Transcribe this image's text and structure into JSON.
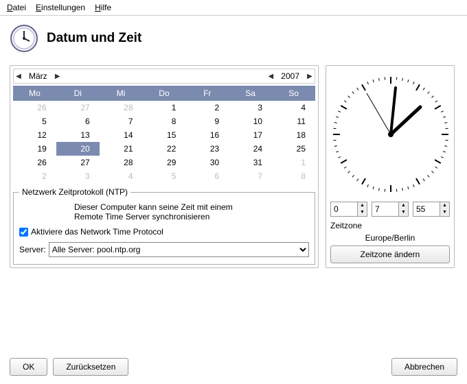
{
  "menu": {
    "file": "Datei",
    "settings": "Einstellungen",
    "help": "Hilfe"
  },
  "title": "Datum und Zeit",
  "month": "März",
  "year": "2007",
  "weekdays": [
    "Mo",
    "Di",
    "Mi",
    "Do",
    "Fr",
    "Sa",
    "So"
  ],
  "cal": {
    "r0": {
      "c0": "26",
      "c1": "27",
      "c2": "28",
      "c3": "1",
      "c4": "2",
      "c5": "3",
      "c6": "4"
    },
    "r1": {
      "c0": "5",
      "c1": "6",
      "c2": "7",
      "c3": "8",
      "c4": "9",
      "c5": "10",
      "c6": "11"
    },
    "r2": {
      "c0": "12",
      "c1": "13",
      "c2": "14",
      "c3": "15",
      "c4": "16",
      "c5": "17",
      "c6": "18"
    },
    "r3": {
      "c0": "19",
      "c1": "20",
      "c2": "21",
      "c3": "22",
      "c4": "23",
      "c5": "24",
      "c6": "25"
    },
    "r4": {
      "c0": "26",
      "c1": "27",
      "c2": "28",
      "c3": "29",
      "c4": "30",
      "c5": "31",
      "c6": "1"
    },
    "r5": {
      "c0": "2",
      "c1": "3",
      "c2": "4",
      "c3": "5",
      "c4": "6",
      "c5": "7",
      "c6": "8"
    }
  },
  "ntp": {
    "legend": "Netzwerk Zeitprotokoll (NTP)",
    "desc1": "Dieser Computer kann seine Zeit mit einem",
    "desc2": "Remote Time Server synchronisieren",
    "checkbox": "Aktiviere das Network Time Protocol",
    "server_label": "Server:",
    "server_value": "Alle Server: pool.ntp.org"
  },
  "time": {
    "h": "0",
    "m": "7",
    "s": "55"
  },
  "tz": {
    "label": "Zeitzone",
    "value": "Europe/Berlin",
    "button": "Zeitzone ändern"
  },
  "buttons": {
    "ok": "OK",
    "reset": "Zurücksetzen",
    "cancel": "Abbrechen"
  }
}
